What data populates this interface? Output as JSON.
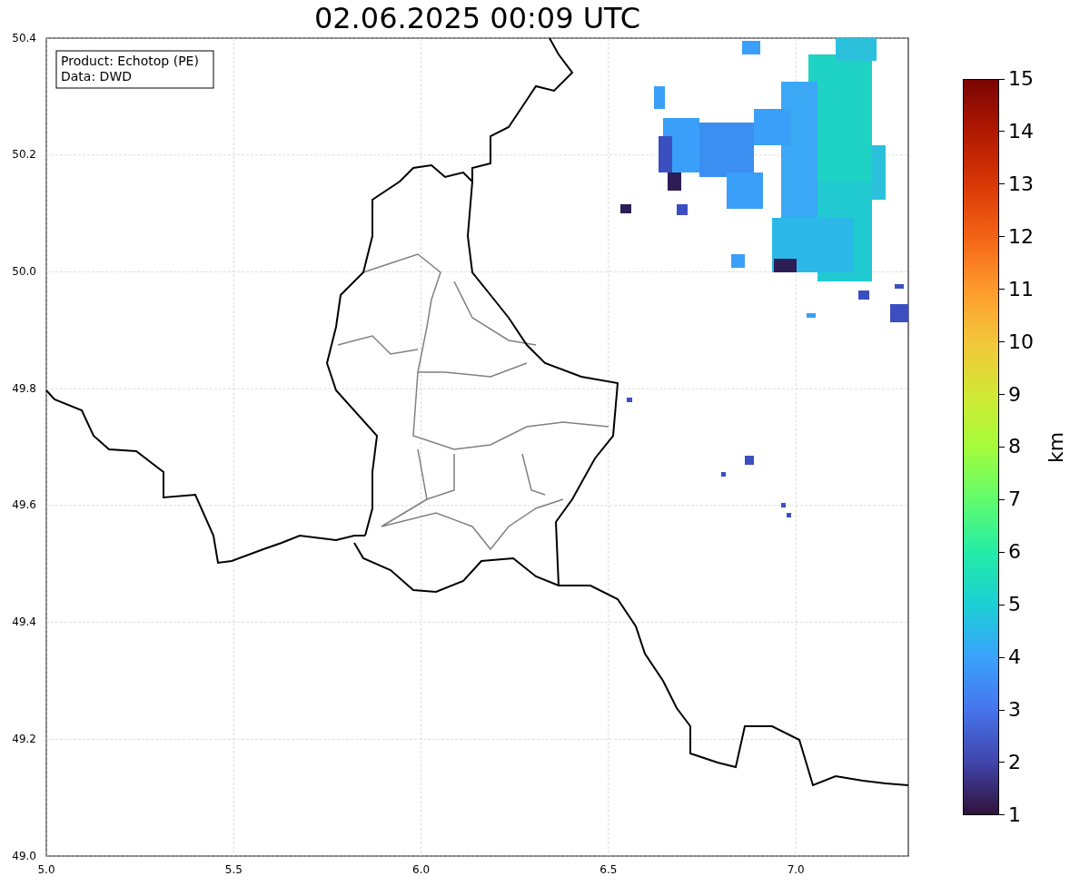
{
  "title": "02.06.2025 00:09 UTC",
  "map": {
    "legend": [
      "Product: Echotop (PE)",
      "Data: DWD"
    ],
    "y_ticks": [
      "50.4",
      "50.2",
      "50.0",
      "49.8",
      "49.6",
      "49.4",
      "49.2",
      "49.0"
    ],
    "x_ticks": [
      "5.0",
      "5.5",
      "6.0",
      "6.5",
      "7.0"
    ]
  },
  "colorbar": {
    "label": "km",
    "ticks": [
      "15",
      "14",
      "13",
      "12",
      "11",
      "10",
      "9",
      "8",
      "7",
      "6",
      "5",
      "4",
      "3",
      "2",
      "1"
    ]
  }
}
